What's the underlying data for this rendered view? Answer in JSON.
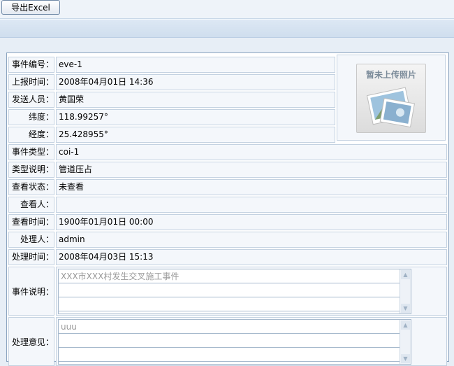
{
  "toolbar": {
    "export_label": "导出Excel"
  },
  "photo": {
    "placeholder_text": "暂未上传照片"
  },
  "fields": [
    {
      "label": "事件编号：",
      "value": "eve-1"
    },
    {
      "label": "上报时间：",
      "value": "2008年04月01日 14:36"
    },
    {
      "label": "发送人员：",
      "value": "黄国荣"
    },
    {
      "label": "纬度：",
      "value": "118.99257°"
    },
    {
      "label": "经度：",
      "value": "25.428955°"
    },
    {
      "label": "事件类型：",
      "value": "coi-1"
    },
    {
      "label": "类型说明：",
      "value": "管道压占"
    },
    {
      "label": "查看状态：",
      "value": "未查看"
    },
    {
      "label": "查看人：",
      "value": ""
    },
    {
      "label": "查看时间：",
      "value": "1900年01月01日 00:00"
    },
    {
      "label": "处理人：",
      "value": "admin"
    },
    {
      "label": "处理时间：",
      "value": "2008年04月03日 15:13"
    }
  ],
  "event_desc": {
    "label": "事件说明：",
    "value": "XXX市XXX村发生交叉施工事件"
  },
  "handle_opinion": {
    "label": "处理意见：",
    "value": "uuu"
  },
  "colors": {
    "border": "#c4d2e1",
    "cell_bg": "#f4f7fb",
    "panel_border": "#8aa3bf"
  }
}
